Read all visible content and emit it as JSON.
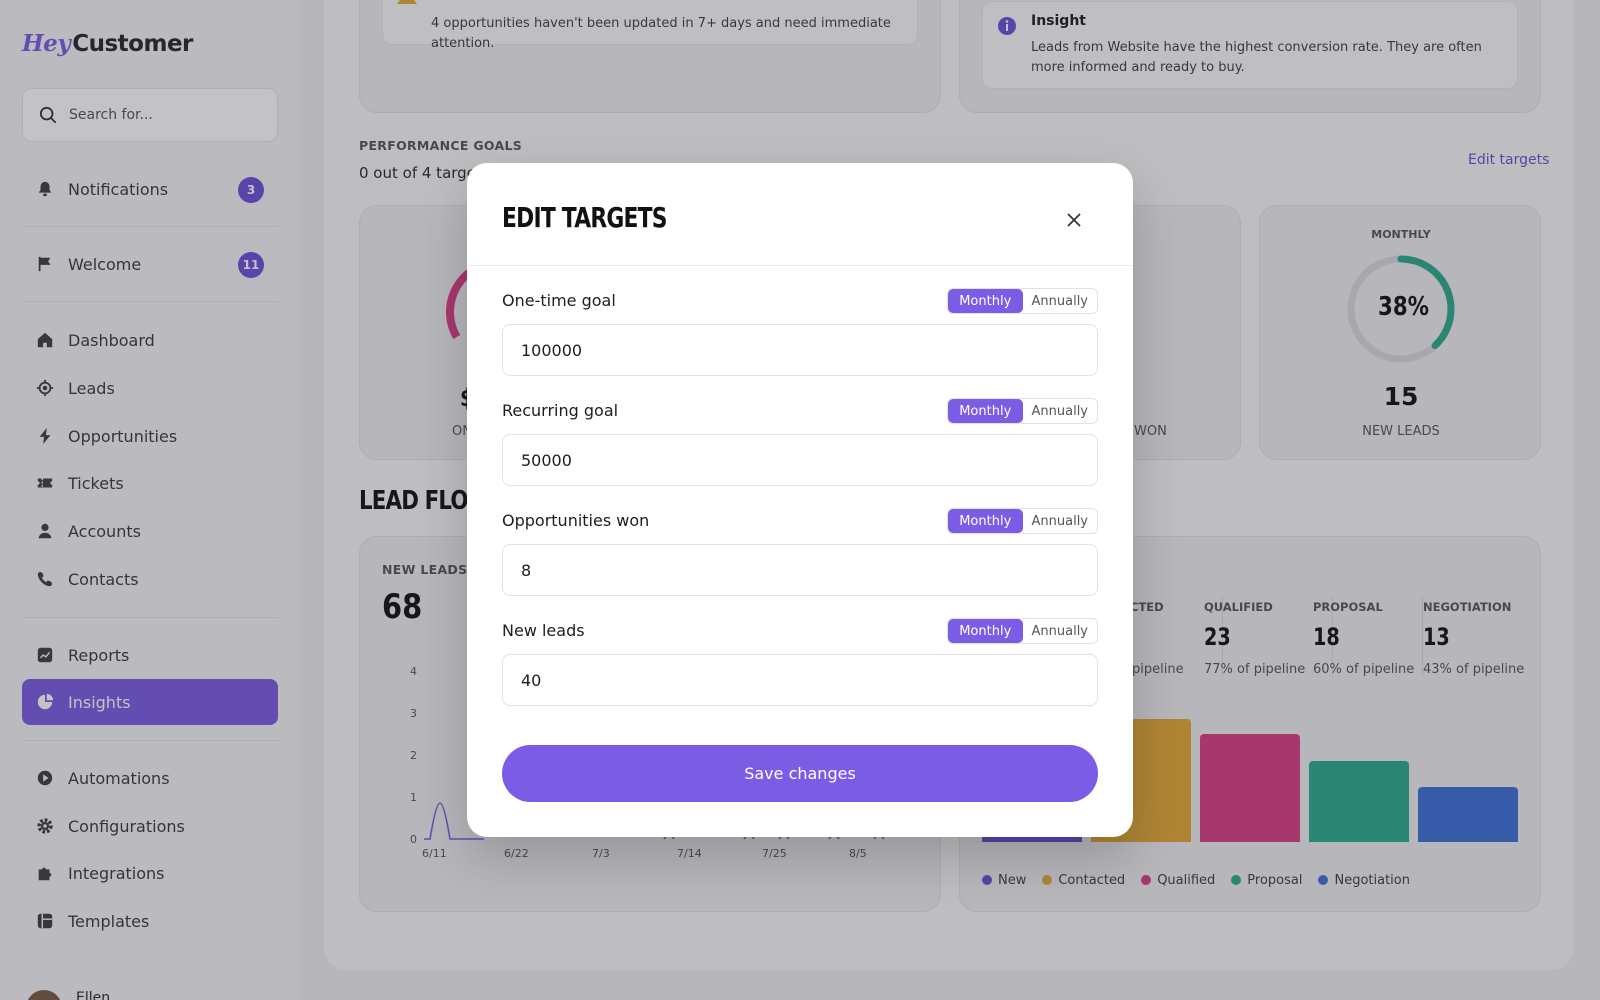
{
  "app": {
    "logo_hey": "Hey",
    "logo_customer": "Customer"
  },
  "search": {
    "placeholder": "Search for..."
  },
  "sidebar": {
    "notifications": {
      "label": "Notifications",
      "badge": "3"
    },
    "welcome": {
      "label": "Welcome",
      "badge": "11"
    },
    "items": [
      {
        "label": "Dashboard"
      },
      {
        "label": "Leads"
      },
      {
        "label": "Opportunities"
      },
      {
        "label": "Tickets"
      },
      {
        "label": "Accounts"
      },
      {
        "label": "Contacts"
      },
      {
        "label": "Reports"
      },
      {
        "label": "Insights"
      },
      {
        "label": "Automations"
      },
      {
        "label": "Configurations"
      },
      {
        "label": "Integrations"
      },
      {
        "label": "Templates"
      }
    ],
    "user_name": "Ellen"
  },
  "alerts": {
    "attention_text": "4 opportunities haven't been updated in 7+ days and need immediate attention.",
    "insight_title": "Insight",
    "insight_text": "Leads from Website have the highest conversion rate. They are often more informed and ready to buy."
  },
  "goals": {
    "title": "PERFORMANCE GOALS",
    "subtitle": "0 out of 4 targets",
    "edit_link": "Edit targets",
    "left_amount": "$",
    "left_label": "ON",
    "won_label": "WON",
    "leads_period": "MONTHLY",
    "leads_percent": "38%",
    "leads_progress": 0.38,
    "leads_value": "15",
    "leads_label": "NEW LEADS"
  },
  "lead_flow": {
    "title": "LEAD FLOW",
    "new_leads_label": "NEW LEADS (L",
    "new_leads_value": "68",
    "y_ticks": [
      "4",
      "3",
      "2",
      "1",
      "0"
    ],
    "x_ticks": [
      "6/11",
      "6/22",
      "7/3",
      "7/14",
      "7/25",
      "8/5"
    ]
  },
  "pipeline": {
    "stages": [
      {
        "label": "CTED",
        "value": "",
        "pct": "pipeline"
      },
      {
        "label": "QUALIFIED",
        "value": "23",
        "pct": "77% of pipeline"
      },
      {
        "label": "PROPOSAL",
        "value": "18",
        "pct": "60% of pipeline"
      },
      {
        "label": "NEGOTIATION",
        "value": "13",
        "pct": "43% of pipeline"
      }
    ],
    "legend": [
      "New",
      "Contacted",
      "Qualified",
      "Proposal",
      "Negotiation"
    ],
    "colors": {
      "new": "#6b4fd6",
      "contacted": "#e3a836",
      "qualified": "#d93d86",
      "proposal": "#2ba98c",
      "negotiation": "#3d6fd8"
    }
  },
  "modal": {
    "title": "EDIT TARGETS",
    "option_monthly": "Monthly",
    "option_annually": "Annually",
    "fields": [
      {
        "label": "One-time goal",
        "value": "100000",
        "period": "Monthly"
      },
      {
        "label": "Recurring goal",
        "value": "50000",
        "period": "Monthly"
      },
      {
        "label": "Opportunities won",
        "value": "8",
        "period": "Monthly"
      },
      {
        "label": "New leads",
        "value": "40",
        "period": "Monthly"
      }
    ],
    "save_label": "Save changes"
  },
  "colors": {
    "accent": "#7b5ce4",
    "badge": "#6c4fd8",
    "leads_ring": "#2ba98c",
    "onetime_ring": "#d93d86"
  }
}
